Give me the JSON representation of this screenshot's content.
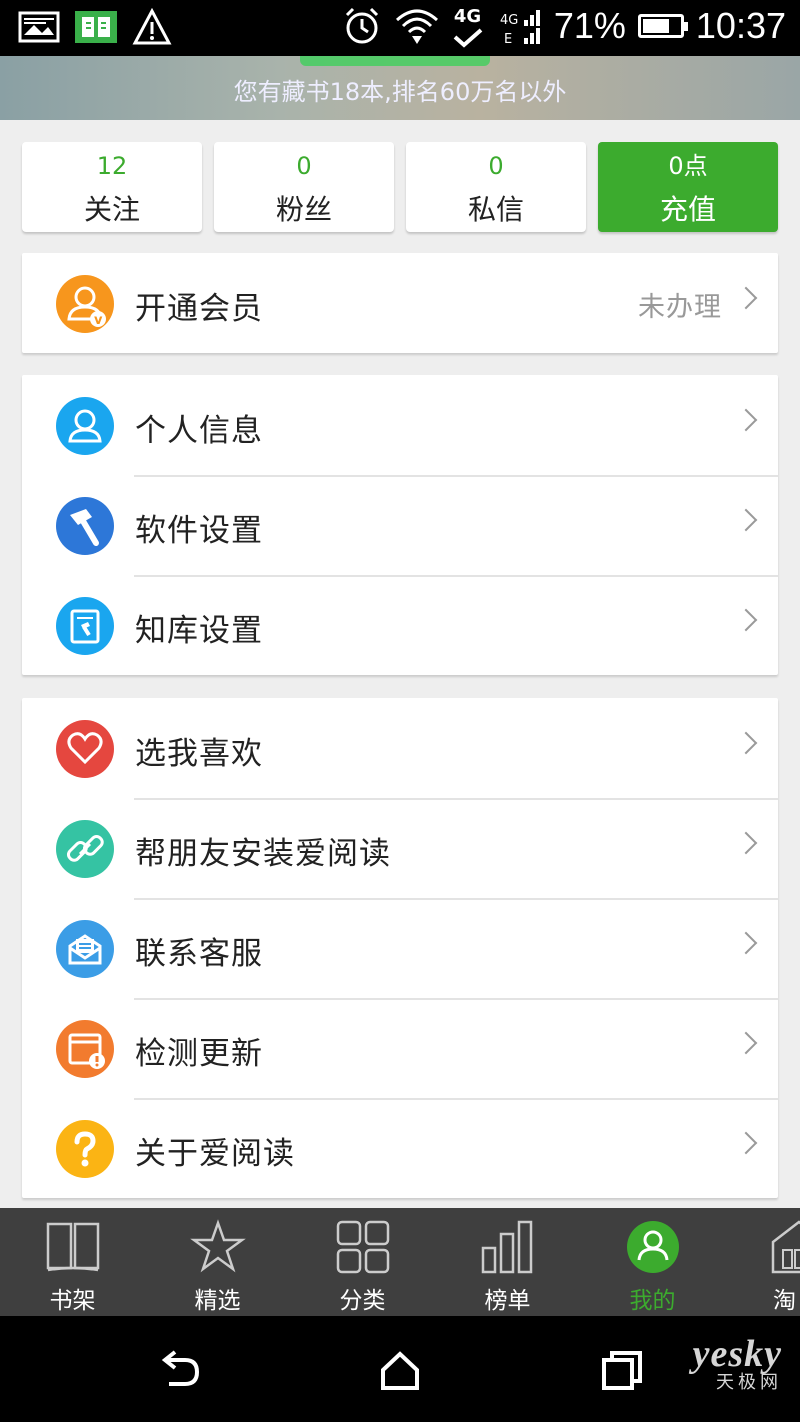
{
  "status_bar": {
    "network": "4G",
    "battery_percent": "71%",
    "battery_level": 0.71,
    "time": "10:37"
  },
  "header": {
    "collection_text": "您有藏书18本,排名60万名以外"
  },
  "stats": [
    {
      "count": "12",
      "label": "关注"
    },
    {
      "count": "0",
      "label": "粉丝"
    },
    {
      "count": "0",
      "label": "私信"
    },
    {
      "count": "0点",
      "label": "充值"
    }
  ],
  "membership": {
    "label": "开通会员",
    "status": "未办理"
  },
  "settings_items": [
    {
      "label": "个人信息",
      "icon": "user-icon",
      "color": "#1aa6ef"
    },
    {
      "label": "软件设置",
      "icon": "hammer-icon",
      "color": "#2d77d8"
    },
    {
      "label": "知库设置",
      "icon": "notebook-icon",
      "color": "#1aa6ef"
    }
  ],
  "misc_items": [
    {
      "label": "选我喜欢",
      "icon": "heart-icon",
      "color": "#e5473f"
    },
    {
      "label": "帮朋友安装爱阅读",
      "icon": "link-icon",
      "color": "#35c3a3"
    },
    {
      "label": "联系客服",
      "icon": "mail-icon",
      "color": "#3b9de6"
    },
    {
      "label": "检测更新",
      "icon": "update-icon",
      "color": "#f27b2e"
    },
    {
      "label": "关于爱阅读",
      "icon": "question-icon",
      "color": "#fbb414"
    }
  ],
  "tabs": [
    {
      "label": "书架",
      "icon": "book-icon"
    },
    {
      "label": "精选",
      "icon": "star-icon"
    },
    {
      "label": "分类",
      "icon": "grid-icon"
    },
    {
      "label": "榜单",
      "icon": "bar-chart-icon"
    },
    {
      "label": "我的",
      "icon": "profile-icon"
    },
    {
      "label": "淘",
      "icon": "shop-icon"
    }
  ],
  "watermark": {
    "line1": "yesky",
    "line2": "天极网"
  },
  "colors": {
    "accent": "#3cab2e",
    "tab_bar": "#3f3f3f"
  }
}
